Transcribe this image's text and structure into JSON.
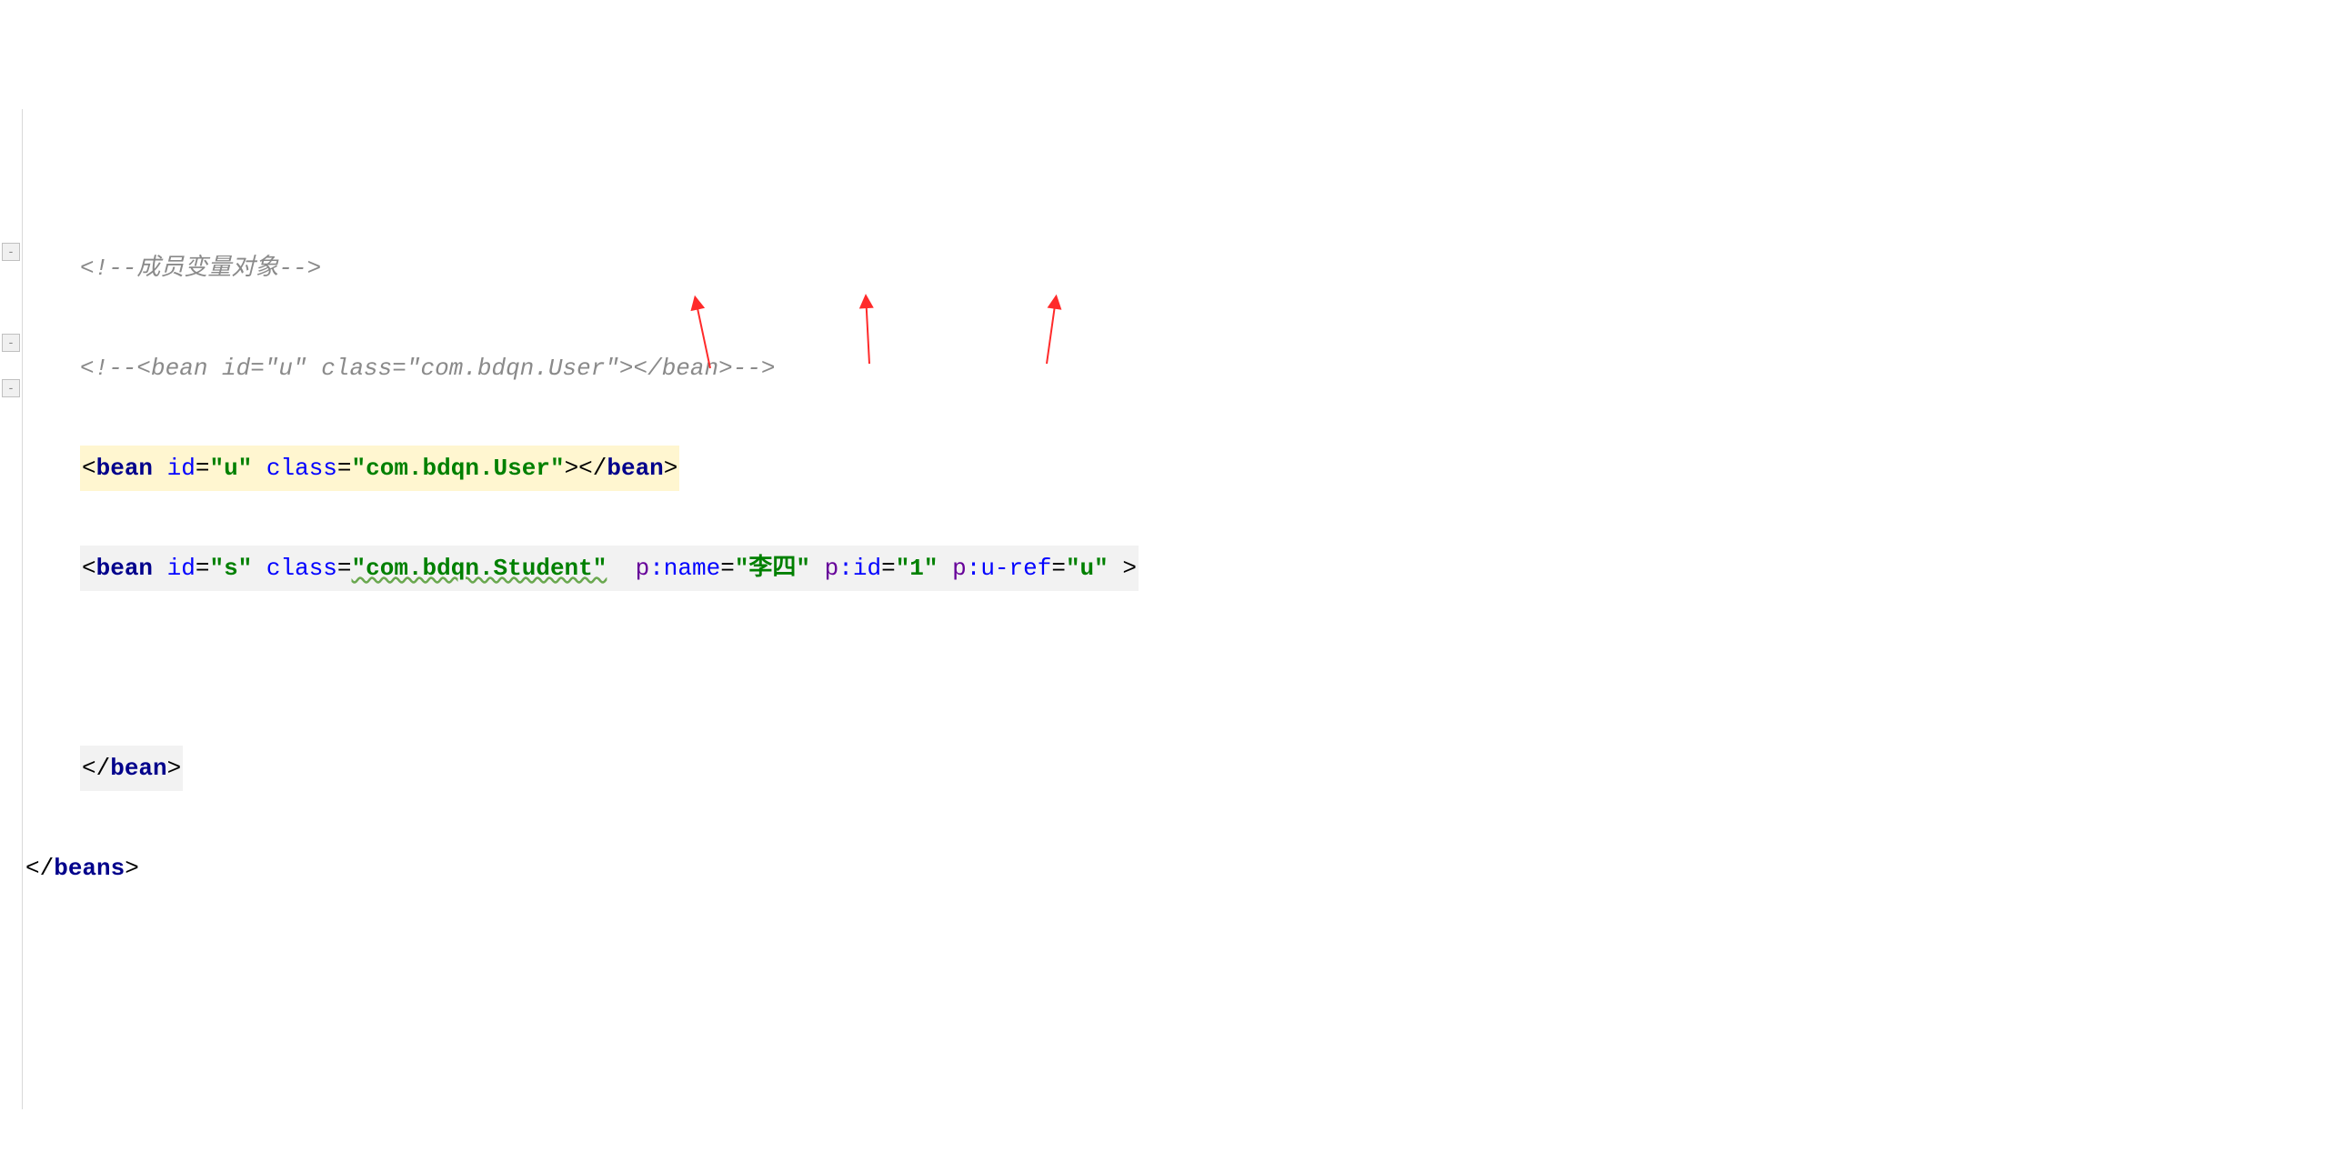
{
  "lines": {
    "l1": {
      "comment_full": "<!--成员变量对象-->"
    },
    "l2": {
      "comment_full": "<!--<bean id=\"u\" class=\"com.bdqn.User\"></bean>-->"
    },
    "l3": {
      "open_brk": "<",
      "tag": "bean",
      "attr_id": "id",
      "val_id": "\"u\"",
      "attr_class": "class",
      "val_class": "\"com.bdqn.User\"",
      "mid_brk": "></",
      "close_tag": "bean",
      "close_brk": ">"
    },
    "l4": {
      "open_brk": "<",
      "tag": "bean",
      "attr_id": "id",
      "val_id": "\"s\"",
      "attr_class": "class",
      "val_class": "\"com.bdqn.Student\"",
      "ns_p1": "p",
      "attr_name": ":name",
      "val_name": "\"李四\"",
      "ns_p2": "p",
      "attr_id2": ":id",
      "val_id2": "\"1\"",
      "ns_p3": "p",
      "attr_uref": ":u-ref",
      "val_uref": "\"u\"",
      "end_brk": " >"
    },
    "l6": {
      "open_brk": "</",
      "tag": "bean",
      "close_brk": ">"
    },
    "l7": {
      "open_brk": "</",
      "tag": "beans",
      "close_brk": ">"
    }
  }
}
